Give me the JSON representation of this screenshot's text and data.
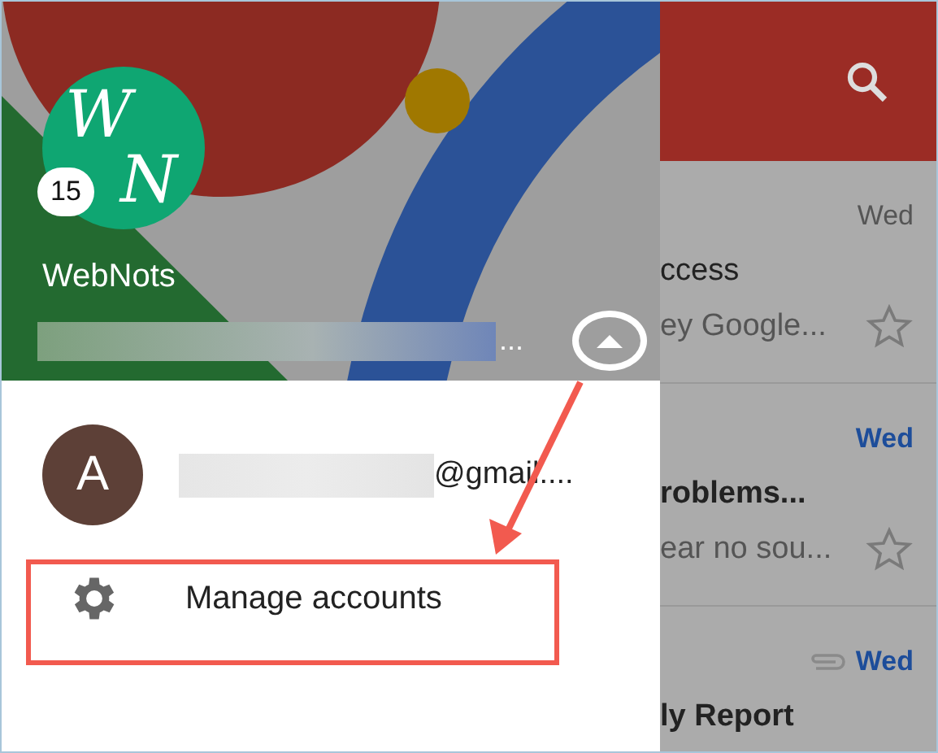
{
  "drawer": {
    "logo_letters": [
      "W",
      "N"
    ],
    "unread_badge": "15",
    "account_name": "WebNots",
    "account_email_tail": "...",
    "switcher_expanded": true,
    "accounts": [
      {
        "initial": "A",
        "email_tail": "@gmail...."
      }
    ],
    "menu": [
      {
        "label": "Manage accounts",
        "kind": "settings",
        "highlighted": true
      }
    ]
  },
  "inbox": {
    "rows": [
      {
        "date": "Wed",
        "unread": false,
        "attachment": false,
        "subject": "ccess",
        "snippet": "ey Google...",
        "starred": false
      },
      {
        "date": "Wed",
        "unread": true,
        "attachment": false,
        "subject": "roblems...",
        "snippet": "ear no sou...",
        "starred": false
      },
      {
        "date": "Wed",
        "unread": true,
        "attachment": true,
        "subject": "ly Report"
      }
    ]
  }
}
